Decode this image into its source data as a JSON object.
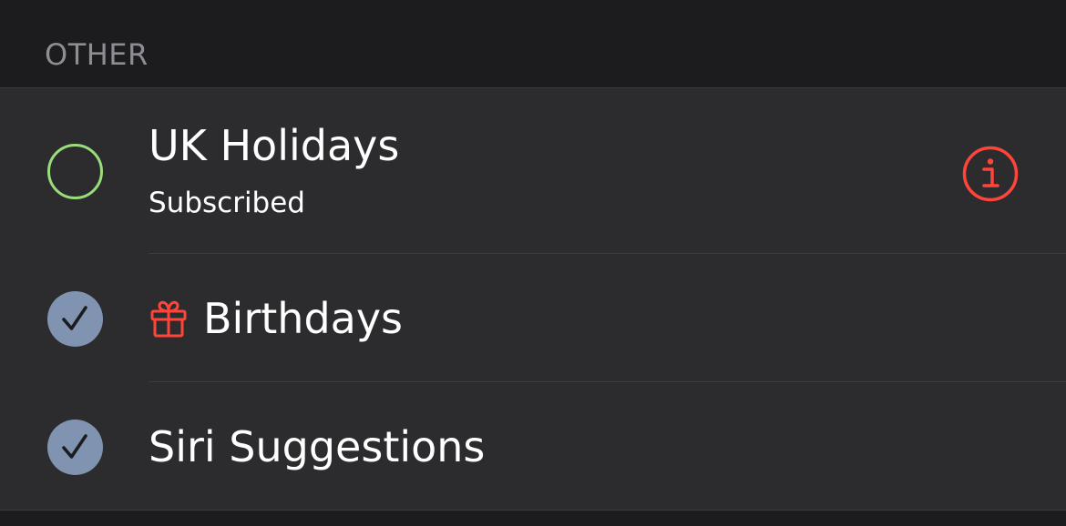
{
  "section": {
    "header": "OTHER"
  },
  "calendars": [
    {
      "title": "UK Holidays",
      "subtitle": "Subscribed",
      "selected": false,
      "circle_color": "#99dd7a",
      "info_icon": "info-circle-icon",
      "info_color": "#ff453a"
    },
    {
      "title": "Birthdays",
      "selected": true,
      "icon": "gift-icon",
      "icon_color": "#ff453a",
      "circle_color": "#8093b0"
    },
    {
      "title": "Siri Suggestions",
      "selected": true,
      "circle_color": "#8093b0"
    }
  ]
}
